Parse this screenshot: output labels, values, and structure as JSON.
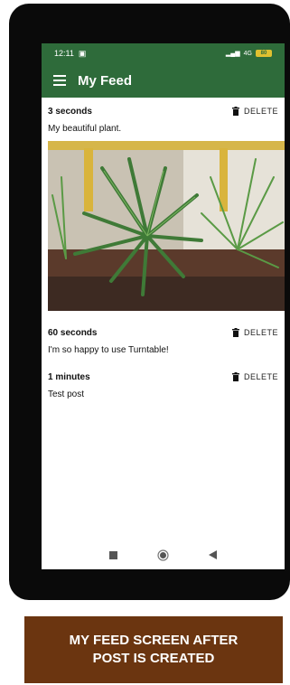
{
  "status_bar": {
    "time": "12:11",
    "signal_text": "4G",
    "battery": "80"
  },
  "app_bar": {
    "title": "My Feed"
  },
  "posts": [
    {
      "time": "3 seconds",
      "delete_label": "DELETE",
      "text": "My beautiful plant.",
      "has_image": true
    },
    {
      "time": "60 seconds",
      "delete_label": "DELETE",
      "text": "I'm so happy to use Turntable!"
    },
    {
      "time": "1 minutes",
      "delete_label": "DELETE",
      "text": "Test post"
    }
  ],
  "icons": [
    "menu-icon",
    "trash-icon",
    "square-icon",
    "circle-icon",
    "back-icon"
  ],
  "colors": {
    "app_bar": "#2e6b3a",
    "caption_bg": "#6b3510"
  },
  "caption": {
    "line1": "MY FEED SCREEN AFTER",
    "line2": "POST IS CREATED"
  }
}
